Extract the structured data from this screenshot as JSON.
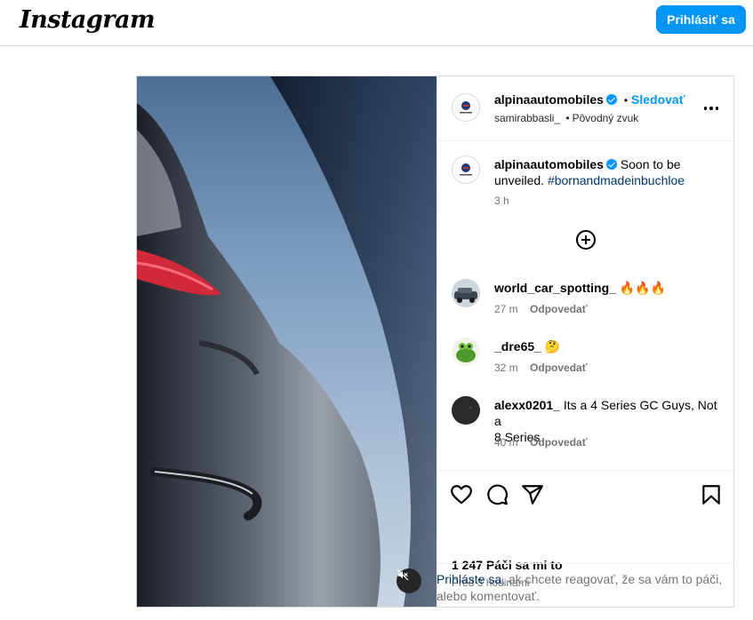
{
  "app": {
    "logo": "Instagram",
    "login_label": "Prihlásiť sa"
  },
  "post": {
    "author": "alpinaautomobiles",
    "follow_label": "Sledovať",
    "separator": "•",
    "audio_user": "samirabbasli_",
    "audio_label": "Pôvodný zvuk",
    "caption": {
      "author": "alpinaautomobiles",
      "text_before": "Soon to be",
      "text_line2": "unveiled.",
      "hashtag": "#bornandmadeinbuchloe",
      "time": "3 h"
    },
    "comments": [
      {
        "user": "world_car_spotting_",
        "text": "🔥🔥🔥",
        "time": "27 m",
        "reply": "Odpovedať"
      },
      {
        "user": "_dre65_",
        "text": "🤔",
        "time": "32 m",
        "reply": "Odpovedať"
      },
      {
        "user": "alexx0201_",
        "text_line1": "Its a 4 Series GC Guys, Not a",
        "text_line2": "8 Series",
        "time": "40 m",
        "reply": "Odpovedať"
      }
    ],
    "likes": "1 247 Páči sa mi to",
    "posted": "Pred 3 hodinami",
    "login_prompt": {
      "link": "Prihláste sa",
      "text_line1": ", ak chcete reagovať, že sa vám to páči,",
      "text_line2": "alebo komentovať."
    }
  },
  "icons": {
    "verified": "verified-badge-icon",
    "more": "more-options-icon",
    "load_more": "plus-circle-icon",
    "like": "heart-icon",
    "comment": "comment-icon",
    "share": "paper-plane-icon",
    "save": "bookmark-icon",
    "mute": "speaker-muted-icon"
  },
  "colors": {
    "accent": "#0095f6",
    "link": "#00376b",
    "muted_text": "#737373",
    "border": "#dbdbdb"
  }
}
